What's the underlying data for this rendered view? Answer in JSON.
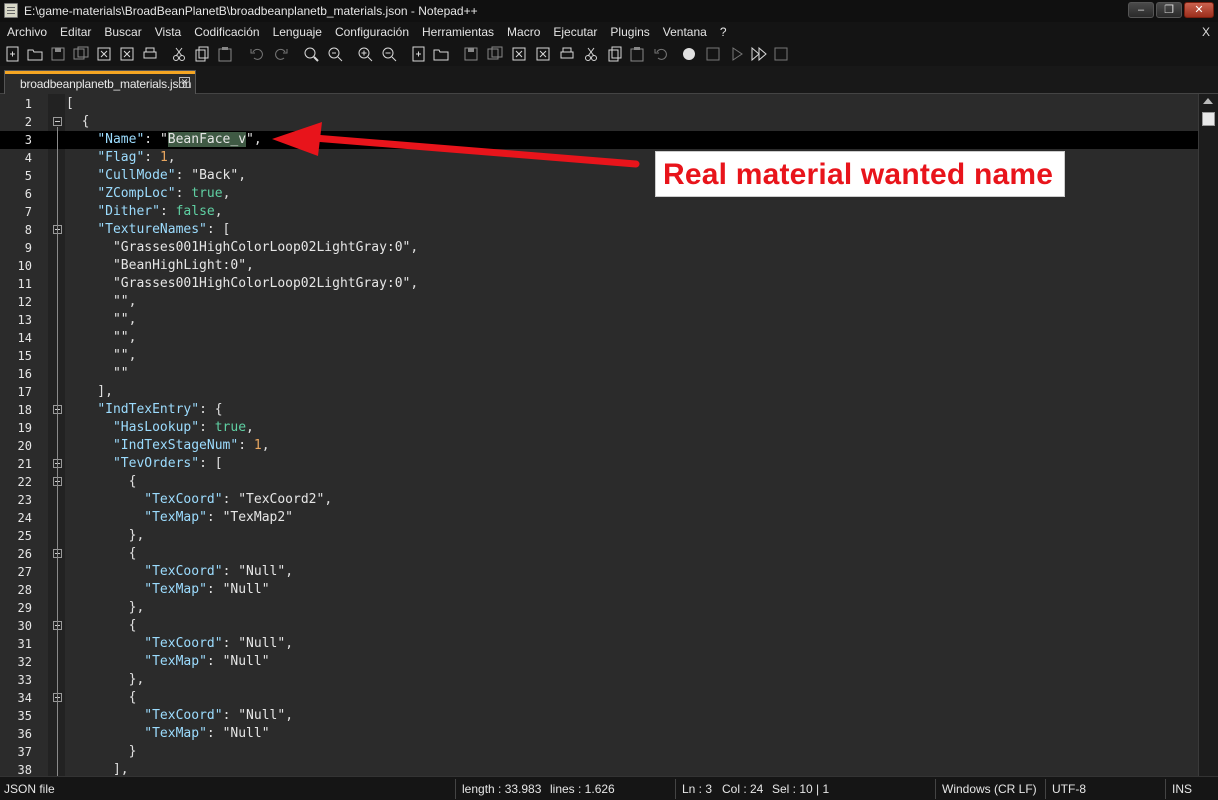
{
  "window": {
    "title": "E:\\game-materials\\BroadBeanPlanetB\\broadbeanplanetb_materials.json - Notepad++",
    "minimize_label": "–",
    "maximize_label": "❐",
    "close_label": "✕"
  },
  "menu": {
    "items": [
      "Archivo",
      "Editar",
      "Buscar",
      "Vista",
      "Codificación",
      "Lenguaje",
      "Configuración",
      "Herramientas",
      "Macro",
      "Ejecutar",
      "Plugins",
      "Ventana",
      "?"
    ],
    "close_doc_label": "X"
  },
  "toolbar": {
    "icons": [
      "new-file-icon",
      "open-file-icon",
      "save-icon",
      "save-all-icon",
      "close-icon",
      "close-all-icon",
      "print-icon",
      "cut-icon",
      "copy-icon",
      "paste-icon",
      "undo-icon",
      "redo-icon",
      "find-icon",
      "replace-icon",
      "zoom-in-icon",
      "zoom-out-icon",
      "sync-vertical-icon",
      "sync-horizontal-icon",
      "word-wrap-icon",
      "show-all-characters-icon",
      "indent-guide-icon",
      "xml-tag-icon",
      "document-map-icon",
      "document-list-icon",
      "function-list-icon",
      "folder-workspace-icon",
      "monitoring-icon",
      "record-macro-icon",
      "stop-record-icon",
      "play-macro-icon",
      "run-macro-multiple-icon",
      "save-macro-icon"
    ]
  },
  "tab": {
    "label": "broadbeanplanetb_materials.json",
    "close_label": "✕",
    "accent_color": "#f5a623"
  },
  "editor": {
    "current_line": 3,
    "lines": [
      {
        "n": "1",
        "text": "["
      },
      {
        "n": "2",
        "text": "  {"
      },
      {
        "n": "3",
        "text": "    \"Name\": \"BeanFace_v\","
      },
      {
        "n": "4",
        "text": "    \"Flag\": 1,"
      },
      {
        "n": "5",
        "text": "    \"CullMode\": \"Back\","
      },
      {
        "n": "6",
        "text": "    \"ZCompLoc\": true,"
      },
      {
        "n": "7",
        "text": "    \"Dither\": false,"
      },
      {
        "n": "8",
        "text": "    \"TextureNames\": ["
      },
      {
        "n": "9",
        "text": "      \"Grasses001HighColorLoop02LightGray:0\","
      },
      {
        "n": "10",
        "text": "      \"BeanHighLight:0\","
      },
      {
        "n": "11",
        "text": "      \"Grasses001HighColorLoop02LightGray:0\","
      },
      {
        "n": "12",
        "text": "      \"\","
      },
      {
        "n": "13",
        "text": "      \"\","
      },
      {
        "n": "14",
        "text": "      \"\","
      },
      {
        "n": "15",
        "text": "      \"\","
      },
      {
        "n": "16",
        "text": "      \"\""
      },
      {
        "n": "17",
        "text": "    ],"
      },
      {
        "n": "18",
        "text": "    \"IndTexEntry\": {"
      },
      {
        "n": "19",
        "text": "      \"HasLookup\": true,"
      },
      {
        "n": "20",
        "text": "      \"IndTexStageNum\": 1,"
      },
      {
        "n": "21",
        "text": "      \"TevOrders\": ["
      },
      {
        "n": "22",
        "text": "        {"
      },
      {
        "n": "23",
        "text": "          \"TexCoord\": \"TexCoord2\","
      },
      {
        "n": "24",
        "text": "          \"TexMap\": \"TexMap2\""
      },
      {
        "n": "25",
        "text": "        },"
      },
      {
        "n": "26",
        "text": "        {"
      },
      {
        "n": "27",
        "text": "          \"TexCoord\": \"Null\","
      },
      {
        "n": "28",
        "text": "          \"TexMap\": \"Null\""
      },
      {
        "n": "29",
        "text": "        },"
      },
      {
        "n": "30",
        "text": "        {"
      },
      {
        "n": "31",
        "text": "          \"TexCoord\": \"Null\","
      },
      {
        "n": "32",
        "text": "          \"TexMap\": \"Null\""
      },
      {
        "n": "33",
        "text": "        },"
      },
      {
        "n": "34",
        "text": "        {"
      },
      {
        "n": "35",
        "text": "          \"TexCoord\": \"Null\","
      },
      {
        "n": "36",
        "text": "          \"TexMap\": \"Null\""
      },
      {
        "n": "37",
        "text": "        }"
      },
      {
        "n": "38",
        "text": "      ],"
      }
    ],
    "fold_lines": [
      "2",
      "8",
      "18",
      "21",
      "22",
      "26",
      "30",
      "34"
    ],
    "selected_text": "BeanFace_v"
  },
  "annotation": {
    "callout_text": "Real material wanted name",
    "color": "#e8141b"
  },
  "status": {
    "filetype": "JSON file",
    "length": "length : 33.983",
    "lines": "lines : 1.626",
    "ln": "Ln : 3",
    "col": "Col : 24",
    "sel": "Sel : 10 | 1",
    "eol": "Windows (CR LF)",
    "encoding": "UTF-8",
    "mode": "INS"
  }
}
